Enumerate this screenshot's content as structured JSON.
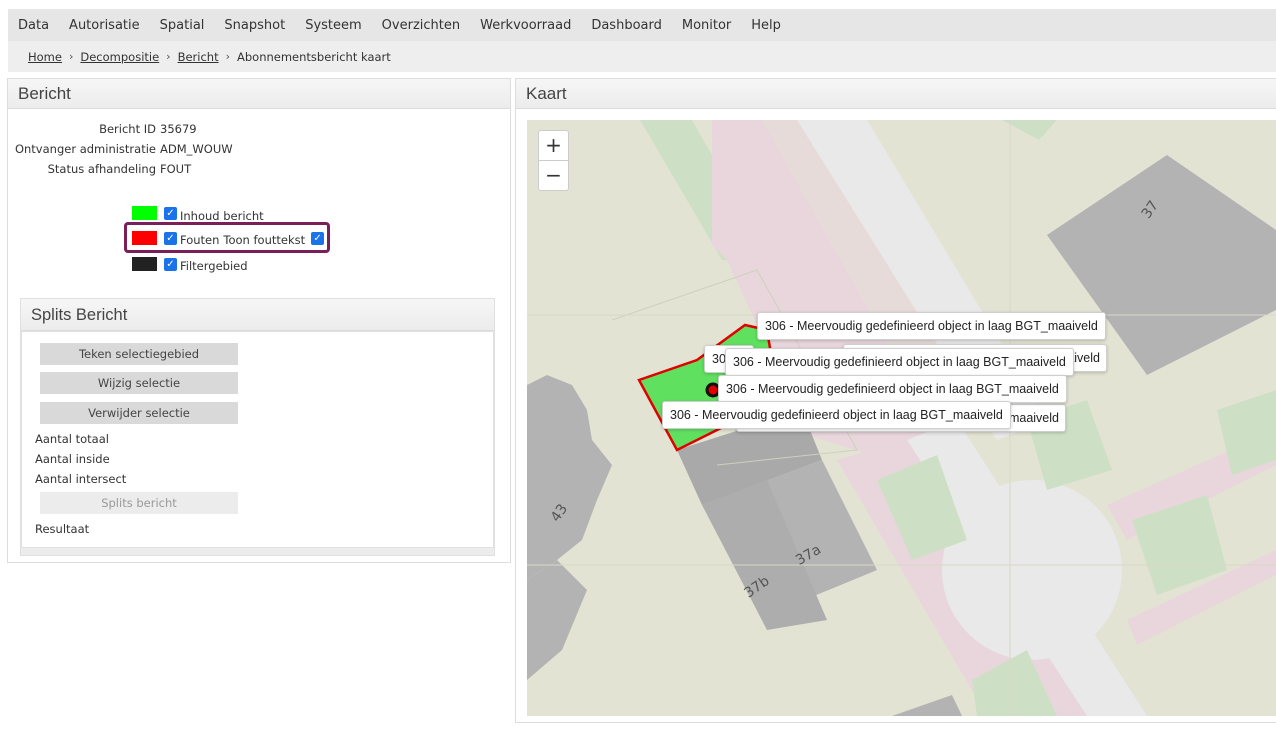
{
  "menu": [
    "Data",
    "Autorisatie",
    "Spatial",
    "Snapshot",
    "Systeem",
    "Overzichten",
    "Werkvoorraad",
    "Dashboard",
    "Monitor",
    "Help"
  ],
  "breadcrumb": {
    "links": [
      "Home",
      "Decompositie",
      "Bericht"
    ],
    "current": "Abonnementsbericht kaart"
  },
  "bericht": {
    "title": "Bericht",
    "fields": [
      {
        "label": "Bericht ID",
        "value": "35679"
      },
      {
        "label": "Ontvanger administratie",
        "value": "ADM_WOUW"
      },
      {
        "label": "Status afhandeling",
        "value": "FOUT"
      }
    ],
    "legend": [
      {
        "label": "Inhoud bericht",
        "color": "#00ff00",
        "checked": true
      },
      {
        "label": "Fouten",
        "color": "#ff0000",
        "checked": true,
        "extra_label": "Toon fouttekst",
        "extra_checked": true
      },
      {
        "label": "Filtergebied",
        "color": "#222222",
        "checked": true
      }
    ]
  },
  "splits": {
    "title": "Splits Bericht",
    "buttons": [
      "Teken selectiegebied",
      "Wijzig selectie",
      "Verwijder selectie"
    ],
    "counts": [
      "Aantal totaal",
      "Aantal inside",
      "Aantal intersect"
    ],
    "splits_button": "Splits bericht",
    "result_label": "Resultaat"
  },
  "kaart": {
    "title": "Kaart",
    "zoom_in": "+",
    "zoom_out": "−",
    "house_numbers": [
      "37",
      "43",
      "37a",
      "37b"
    ],
    "tooltips": [
      "306 - Meervoudig gedefinieerd object in laag BGT_maaiveld",
      "306 - Meervoudig gedefinieerd object in laag BGT_maaiveld",
      "306 - Meervoudig gedefinieerd object in laag BGT_maaiveld",
      "306 - Meervoudig gedefinieerd object in laag BGT_maaiveld"
    ],
    "tooltip_fragments": [
      "aaiveld",
      "GT_maaiveld",
      "306"
    ]
  }
}
